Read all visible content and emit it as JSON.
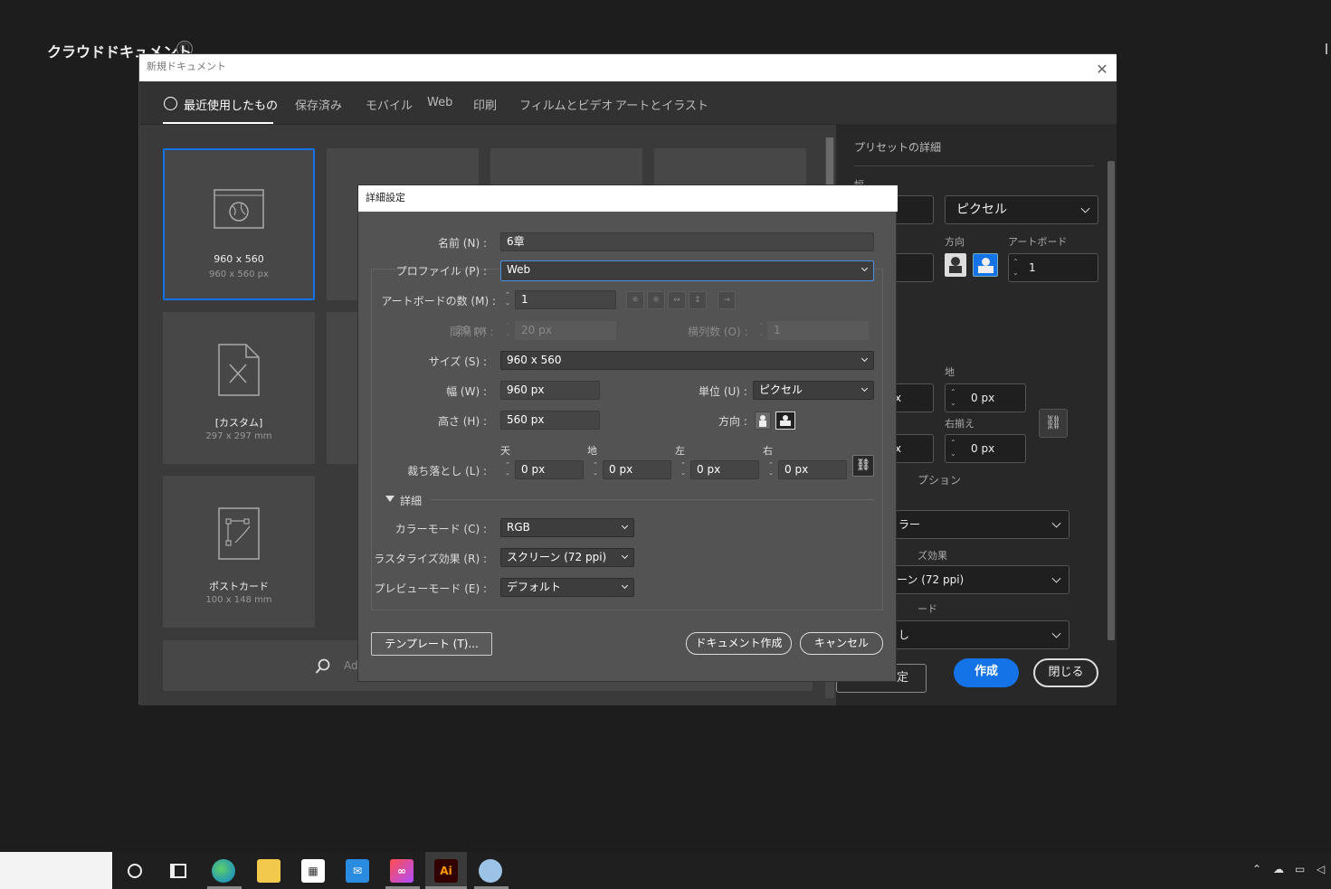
{
  "background": {
    "title": "クラウドドキュメント",
    "info_icon": "ⓘ"
  },
  "new_doc": {
    "window_title": "新規ドキュメント",
    "close_symbol": "✕",
    "tabs": [
      "最近使用したもの",
      "保存済み",
      "モバイル",
      "Web",
      "印刷",
      "フィルムとビデオ",
      "アートとイラスト"
    ],
    "cards": [
      {
        "title": "960 x 560",
        "size": "960 x 560 px",
        "icon": "web-document-icon"
      },
      {
        "title": "[カスタム]",
        "size": "297 x 297 mm",
        "icon": "custom-document-icon"
      },
      {
        "title": "ポストカード",
        "size": "100 x 148 mm",
        "icon": "postcard-document-icon"
      }
    ],
    "search_placeholder": "Ad"
  },
  "preset": {
    "title": "プリセットの詳細",
    "width_label": "幅",
    "unit_value": "ピクセル",
    "orientation_label": "方向",
    "artboard_label": "アートボード",
    "artboard_value": "1",
    "bottom_label": "地",
    "bottom_value": "0 px",
    "right_label": "右揃え",
    "right_value": "0 px",
    "partial_px1": "x",
    "partial_px2": "x",
    "option_label": "プション",
    "color_value": "ラー",
    "raster_label": "ズ効果",
    "raster_value": "ーン (72 ppi)",
    "mode_label": "ード",
    "mode_value": "し",
    "settings_button": "定",
    "create_button": "作成",
    "close_button": "閉じる"
  },
  "dialog": {
    "title": "詳細設定",
    "name_label": "名前 (N) :",
    "name_value": "6章",
    "profile_label": "プロファイル (P) :",
    "profile_value": "Web",
    "artboards_label": "アートボードの数 (M) :",
    "artboards_value": "1",
    "spacing_label": "間隔 (I) :",
    "spacing_value": "20 px",
    "columns_label": "横列数 (O) :",
    "columns_value": "1",
    "size_label": "サイズ (S) :",
    "size_value": "960 x 560",
    "width_label": "幅 (W) :",
    "width_value": "960 px",
    "units_label": "単位 (U) :",
    "units_value": "ピクセル",
    "height_label": "高さ (H) :",
    "height_value": "560 px",
    "orientation_label": "方向 :",
    "bleed_label": "裁ち落とし (L) :",
    "bleed": [
      {
        "label": "天",
        "value": "0 px"
      },
      {
        "label": "地",
        "value": "0 px"
      },
      {
        "label": "左",
        "value": "0 px"
      },
      {
        "label": "右",
        "value": "0 px"
      }
    ],
    "advanced_label": "詳細",
    "color_mode_label": "カラーモード (C) :",
    "color_mode_value": "RGB",
    "raster_label": "ラスタライズ効果 (R) :",
    "raster_value": "スクリーン (72 ppi)",
    "preview_label": "プレビューモード (E) :",
    "preview_value": "デフォルト",
    "template_button": "テンプレート (T)...",
    "create_button": "ドキュメント作成",
    "cancel_button": "キャンセル"
  },
  "taskbar": {
    "apps": [
      "cortana-icon",
      "task-view-icon",
      "edge-icon",
      "explorer-icon",
      "store-icon",
      "mail-icon",
      "creative-cloud-icon",
      "illustrator-icon",
      "paint-icon"
    ],
    "ai_label": "Ai"
  },
  "colors": {
    "accent": "#1473e6",
    "dialog_bg": "#535353",
    "window_bg": "#323232",
    "ai_bg": "#330000",
    "ai_fg": "#ff9a00"
  }
}
